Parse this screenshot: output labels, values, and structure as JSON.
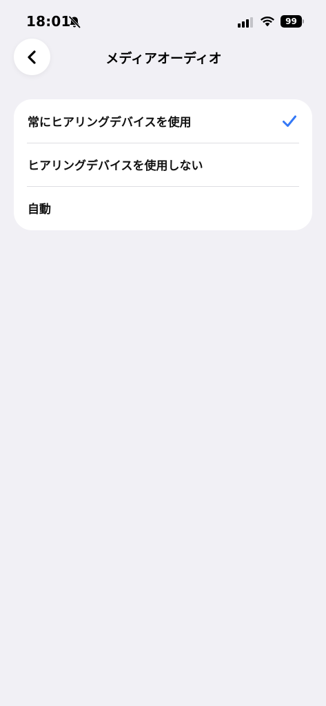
{
  "status_bar": {
    "time": "18:01",
    "battery": "99",
    "icons": [
      "bell-slash-icon",
      "cellular-signal-icon",
      "wifi-icon",
      "battery-icon"
    ]
  },
  "nav": {
    "title": "メディアオーディオ",
    "back_icon": "chevron-left-icon"
  },
  "options": [
    {
      "label": "常にヒアリングデバイスを使用",
      "selected": true
    },
    {
      "label": "ヒアリングデバイスを使用しない",
      "selected": false
    },
    {
      "label": "自動",
      "selected": false
    }
  ],
  "colors": {
    "background": "#f1f0f5",
    "card": "#ffffff",
    "accent": "#3478f6",
    "separator": "#dedee2"
  }
}
